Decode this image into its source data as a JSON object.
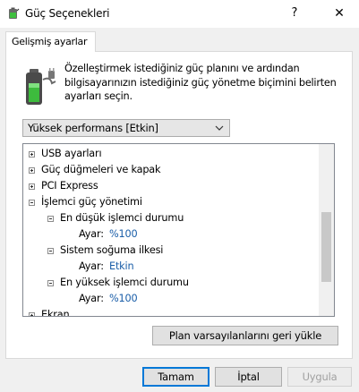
{
  "window": {
    "title": "Güç Seçenekleri",
    "help_glyph": "?",
    "close_glyph": "✕",
    "icons": [
      "battery-plug-icon",
      "help-icon",
      "close-icon"
    ]
  },
  "tabs": [
    {
      "label": "Gelişmiş ayarlar",
      "selected": true
    }
  ],
  "description": [
    "Özelleştirmek istediğiniz güç planını ve ardından",
    "bilgisayarınızın istediğiniz güç yönetme biçimini belirten",
    "ayarları seçin."
  ],
  "plan_select": {
    "value": "Yüksek performans [Etkin]"
  },
  "tree": {
    "items": [
      {
        "label": "USB ayarları",
        "expanded": false
      },
      {
        "label": "Güç düğmeleri ve kapak",
        "expanded": false
      },
      {
        "label": "PCI Express",
        "expanded": false
      },
      {
        "label": "İşlemci güç yönetimi",
        "expanded": true
      },
      {
        "label": "En düşük işlemci durumu",
        "expanded": true
      },
      {
        "setting_label": "Ayar:",
        "value": "%100"
      },
      {
        "label": "Sistem soğuma ilkesi",
        "expanded": true
      },
      {
        "setting_label": "Ayar:",
        "value": "Etkin"
      },
      {
        "label": "En yüksek işlemci durumu",
        "expanded": true
      },
      {
        "setting_label": "Ayar:",
        "value": "%100"
      },
      {
        "label": "Ekran",
        "expanded": false
      }
    ]
  },
  "restore_button": "Plan varsayılanlarını geri yükle",
  "footer": {
    "ok": "Tamam",
    "cancel": "İptal",
    "apply": "Uygula"
  },
  "colors": {
    "setting_value": "#1a5ea8",
    "focus_border": "#0078d7"
  }
}
